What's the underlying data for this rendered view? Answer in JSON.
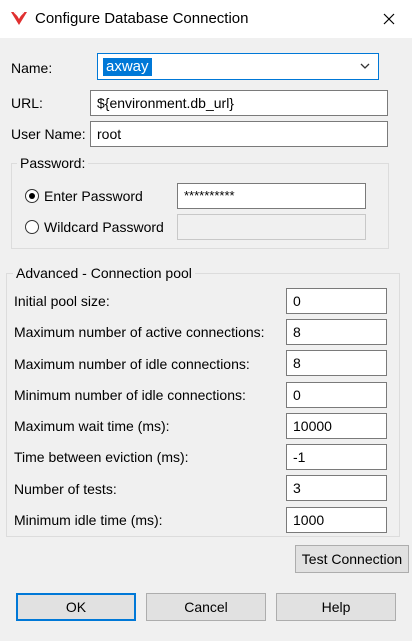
{
  "window": {
    "title": "Configure Database Connection",
    "app_icon": "axway-logo-icon",
    "close_icon": "close-icon"
  },
  "connection": {
    "name_label": "Name:",
    "name_value": "axway",
    "url_label": "URL:",
    "url_value": "${environment.db_url}",
    "username_label": "User Name:",
    "username_value": "root"
  },
  "password": {
    "group_label": "Password:",
    "enter_label": "Enter Password",
    "enter_value": "**********",
    "enter_selected": true,
    "wildcard_label": "Wildcard Password",
    "wildcard_value": "",
    "wildcard_selected": false
  },
  "pool": {
    "group_label": "Advanced - Connection pool",
    "rows": [
      {
        "label": "Initial pool size:",
        "value": "0"
      },
      {
        "label": "Maximum number of active connections:",
        "value": "8"
      },
      {
        "label": "Maximum number of idle connections:",
        "value": "8"
      },
      {
        "label": "Minimum number of idle connections:",
        "value": "0"
      },
      {
        "label": "Maximum wait time (ms):",
        "value": "10000"
      },
      {
        "label": "Time between eviction (ms):",
        "value": "-1"
      },
      {
        "label": "Number of tests:",
        "value": "3"
      },
      {
        "label": "Minimum idle time (ms):",
        "value": "1000"
      }
    ]
  },
  "buttons": {
    "test_connection": "Test Connection",
    "ok": "OK",
    "cancel": "Cancel",
    "help": "Help"
  },
  "colors": {
    "accent": "#0078d7",
    "logo": "#e03030"
  }
}
